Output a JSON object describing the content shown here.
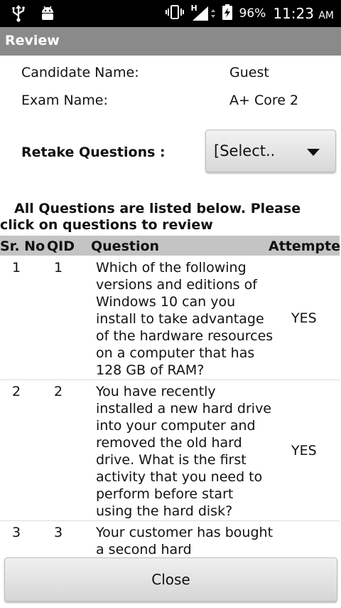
{
  "status_bar": {
    "battery": "96%",
    "time": "11:23",
    "ampm": "AM",
    "network": "H"
  },
  "app_bar": {
    "title": "Review"
  },
  "candidate": {
    "label": "Candidate Name:",
    "value": "Guest"
  },
  "exam": {
    "label": "Exam Name:",
    "value": "A+ Core 2"
  },
  "retake": {
    "label": "Retake Questions :",
    "selected": "[Select.."
  },
  "instruction": "All Questions are listed below. Please click on questions to review",
  "table": {
    "headers": {
      "sr": "Sr. No",
      "qid": "QID",
      "question": "Question",
      "attempted": "Attempted"
    },
    "rows": [
      {
        "sr": "1",
        "qid": "1",
        "question": "Which of the following versions and editions of Windows 10 can you install to take advantage of the hardware resources on a computer that has 128 GB of  RAM?",
        "attempted": "YES"
      },
      {
        "sr": "2",
        "qid": "2",
        "question": "You have recently installed a new hard drive into your computer and removed the old hard drive. What is the first activity that you need to perform before start using the hard disk?",
        "attempted": "YES"
      },
      {
        "sr": "3",
        "qid": "3",
        "question": "Your customer has bought a second hard",
        "attempted": ""
      }
    ]
  },
  "close_label": "Close"
}
